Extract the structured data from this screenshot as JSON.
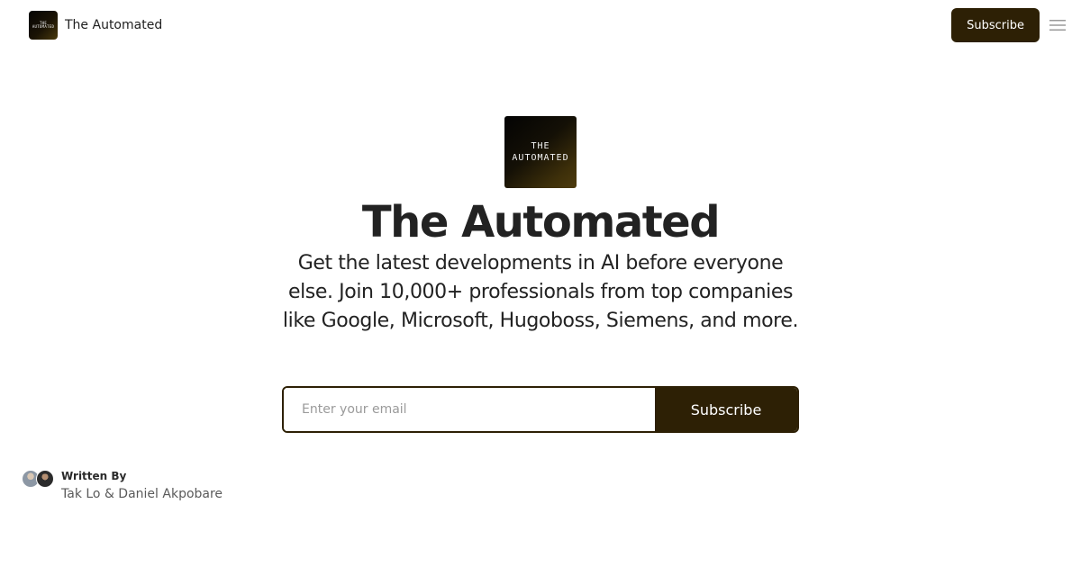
{
  "header": {
    "brand_name": "The Automated",
    "logo_text": [
      "THE",
      "AUTOMATED"
    ],
    "subscribe_label": "Subscribe",
    "menu_icon": "hamburger-icon"
  },
  "hero": {
    "logo_text": [
      "THE",
      "AUTOMATED"
    ],
    "title": "The Automated",
    "description": "Get the latest developments in AI before everyone else. Join 10,000+ professionals from top companies like Google, Microsoft, Hugoboss, Siemens, and more.",
    "email_placeholder": "Enter your email",
    "subscribe_label": "Subscribe"
  },
  "authors": {
    "label": "Written By",
    "names": "Tak Lo & Daniel Akpobare"
  },
  "colors": {
    "accent": "#2d2005",
    "text": "#222222",
    "muted": "#5a5a5a"
  }
}
